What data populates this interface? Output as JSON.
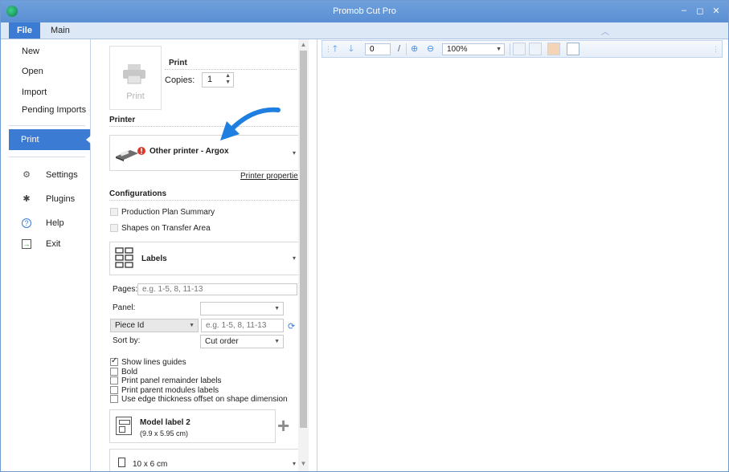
{
  "window": {
    "title": "Promob Cut Pro",
    "controls": {
      "minimize": "‒",
      "maximize": "◻",
      "close": "✕"
    }
  },
  "ribbon": {
    "tabs": [
      {
        "label": "File",
        "active": true
      },
      {
        "label": "Main",
        "active": false
      }
    ],
    "collapse_icon": "chevron-up-icon"
  },
  "filemenu": {
    "items": [
      {
        "label": "New"
      },
      {
        "label": "Open"
      },
      {
        "label": "Import"
      },
      {
        "label": "Pending Imports"
      },
      {
        "label": "Print",
        "active": true
      },
      {
        "label": "Settings",
        "icon": "gear-icon"
      },
      {
        "label": "Plugins",
        "icon": "puzzle-icon"
      },
      {
        "label": "Help",
        "icon": "help-icon"
      },
      {
        "label": "Exit",
        "icon": "exit-icon"
      }
    ]
  },
  "print_section": {
    "title": "Print",
    "tile_label": "Print",
    "copies_label": "Copies:",
    "copies_value": "1"
  },
  "printer_section": {
    "title": "Printer",
    "printer_name": "Other printer - Argox",
    "properties_link": "Printer properties"
  },
  "configurations": {
    "title": "Configurations",
    "checkboxes": [
      {
        "label": "Production Plan Summary",
        "checked": false,
        "enabled": false
      },
      {
        "label": "Shapes on Transfer Area",
        "checked": false,
        "enabled": false
      }
    ],
    "report_type": "Labels",
    "pages_label": "Pages:",
    "pages_placeholder": "e.g. 1-5, 8, 11-13",
    "panel_label": "Panel:",
    "panel_value": "",
    "filter_select": "Piece Id",
    "filter_placeholder": "e.g. 1-5, 8, 11-13",
    "sort_label": "Sort by:",
    "sort_value": "Cut order",
    "options": [
      {
        "label": "Show lines guides",
        "checked": true
      },
      {
        "label": "Bold",
        "checked": false
      },
      {
        "label": "Print panel remainder labels",
        "checked": false
      },
      {
        "label": "Print parent modules labels",
        "checked": false
      },
      {
        "label": "Use edge thickness offset on shape dimension",
        "checked": false
      }
    ],
    "model_name": "Model label 2",
    "model_size": "(9.9 x 5.95 cm)",
    "label_size": "10 x 6 cm"
  },
  "preview_toolbar": {
    "page_value": "0",
    "page_total": "/",
    "zoom_value": "100%"
  },
  "colors": {
    "titlebar": "#5a8fd3",
    "accent": "#3b7bd4",
    "arrow": "#1f7fe0"
  }
}
